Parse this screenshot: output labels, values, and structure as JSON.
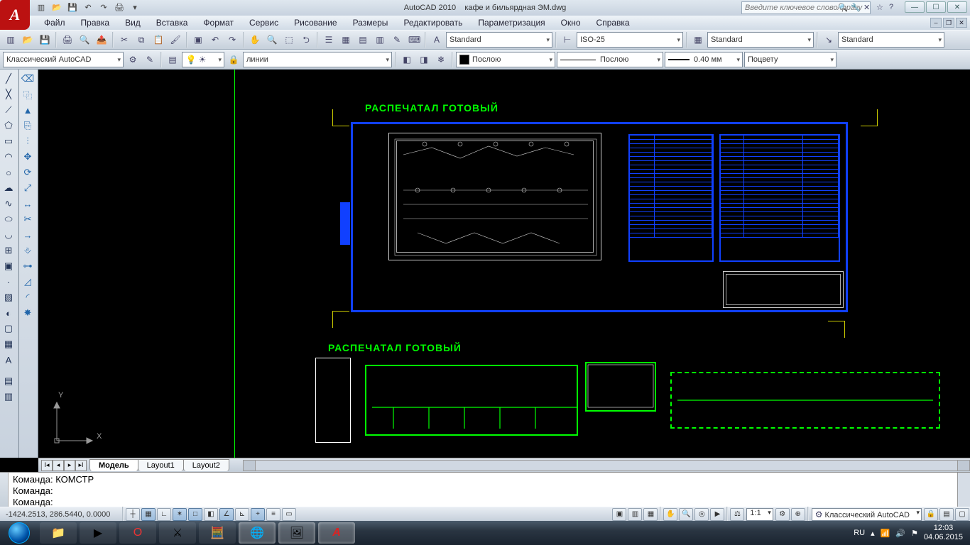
{
  "app": {
    "name": "AutoCAD 2010",
    "doc": "кафе и бильярдная  ЭМ.dwg"
  },
  "search_placeholder": "Введите ключевое слово/фразу",
  "menu": [
    "Файл",
    "Правка",
    "Вид",
    "Вставка",
    "Формат",
    "Сервис",
    "Рисование",
    "Размеры",
    "Редактировать",
    "Параметризация",
    "Окно",
    "Справка"
  ],
  "row1": {
    "text_style": "Standard",
    "dim_style": "ISO-25",
    "table_style": "Standard",
    "mleader_style": "Standard"
  },
  "row2": {
    "workspace": "Классический AutoCAD",
    "layer": "линии",
    "color": "Послою",
    "linetype": "Послою",
    "lineweight": "0.40 мм",
    "plotstyle": "Поцвету"
  },
  "drawing": {
    "label": "РАСПЕЧАТАЛ  ГОТОВЫЙ",
    "ucs_y": "Y",
    "ucs_x": "X"
  },
  "tabs": {
    "active": "Модель",
    "others": [
      "Layout1",
      "Layout2"
    ]
  },
  "cmd": {
    "line1": "Команда: КОМСТР",
    "line2": "Команда:",
    "prompt": "Команда:"
  },
  "status": {
    "coords": "-1424.2513, 286.5440, 0.0000",
    "scale": "1:1",
    "workspace": "Классический AutoCAD"
  },
  "tray": {
    "lang": "RU",
    "time": "12:03",
    "date": "04.06.2015"
  }
}
